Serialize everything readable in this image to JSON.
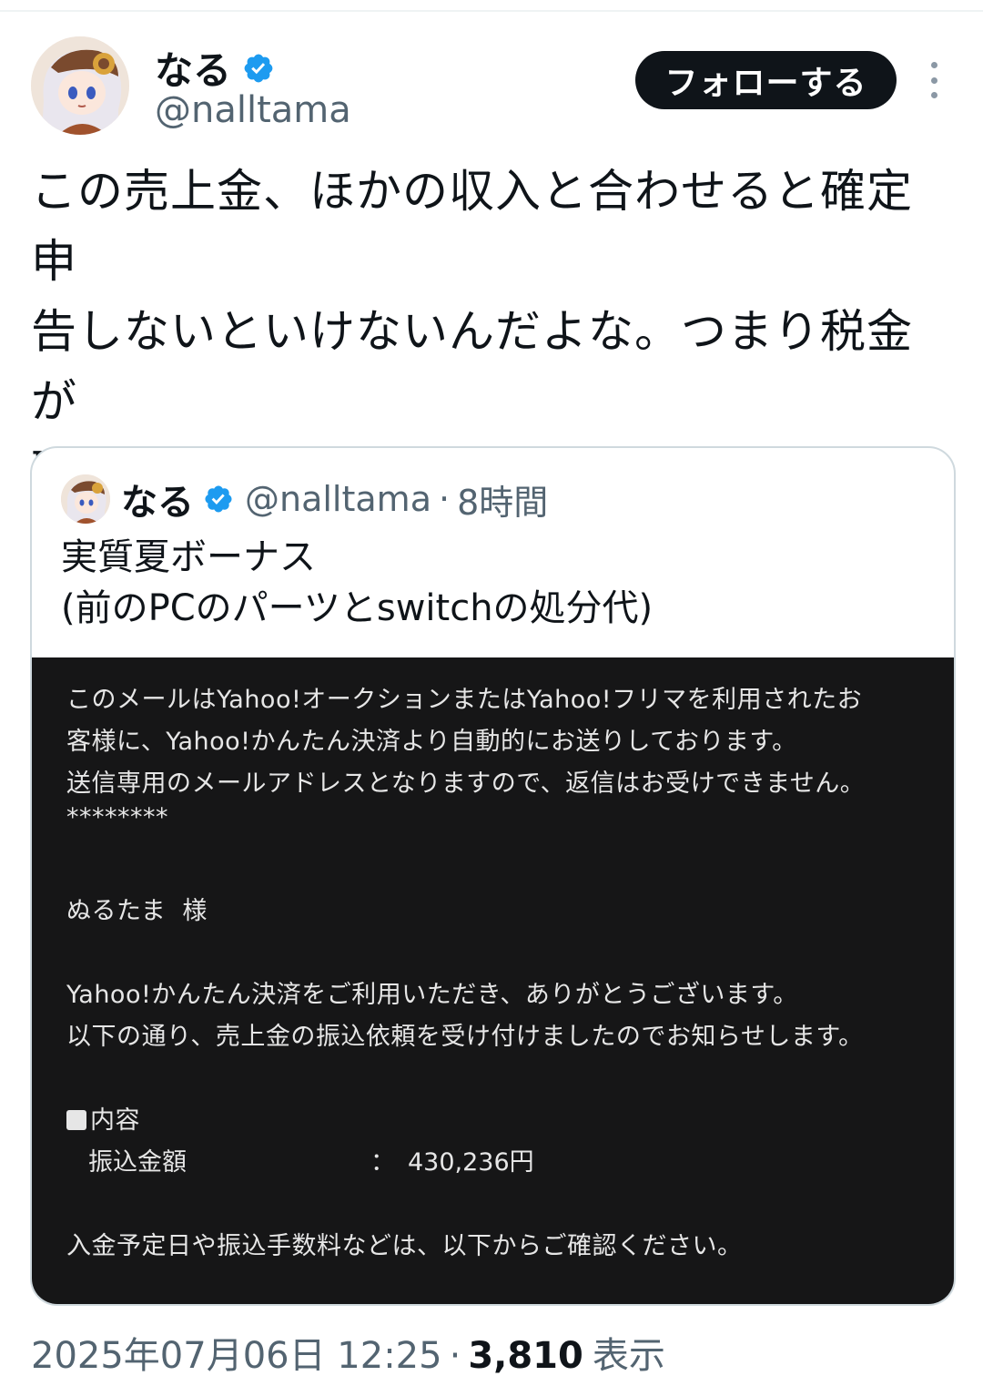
{
  "post": {
    "display_name": "なる",
    "handle": "@nalltama",
    "follow_label": "フォローする",
    "text": "この売上金、ほかの収入と合わせると確定申\n告しないといけないんだよな。つまり税金が\n取られる。\n石破茂はクソ",
    "timestamp": "2025年07月06日 12:25",
    "separator": "·",
    "views_count": "3,810",
    "views_label": "表示"
  },
  "quote": {
    "display_name": "なる",
    "handle": "@nalltama",
    "separator": "·",
    "time": "8時間",
    "text": "実質夏ボーナス\n(前のPCのパーツとswitchの処分代)",
    "email": {
      "line1": "このメールはYahoo!オークションまたはYahoo!フリマを利用されたお",
      "line2": "客様に、Yahoo!かんたん決済より自動的にお送りしております。",
      "line3": "送信専用のメールアドレスとなりますので、返信はお受けできません。",
      "line4": "********",
      "line5": "ぬるたま  様",
      "line6": "Yahoo!かんたん決済をご利用いただき、ありがとうございます。",
      "line7": "以下の通り、売上金の振込依頼を受け付けましたのでお知らせします。",
      "section": "内容",
      "amount_label": "振込金額",
      "amount_colon": "：",
      "amount_value": "430,236円",
      "line8": "入金予定日や振込手数料などは、以下からご確認ください。"
    }
  },
  "colors": {
    "text_primary": "#0f1419",
    "text_secondary": "#536471",
    "verified": "#1d9bf0",
    "button_bg": "#0f1419",
    "email_bg": "#161617"
  },
  "icons": [
    "avatar-anime-girl",
    "verified-badge-icon",
    "more-options-icon"
  ]
}
